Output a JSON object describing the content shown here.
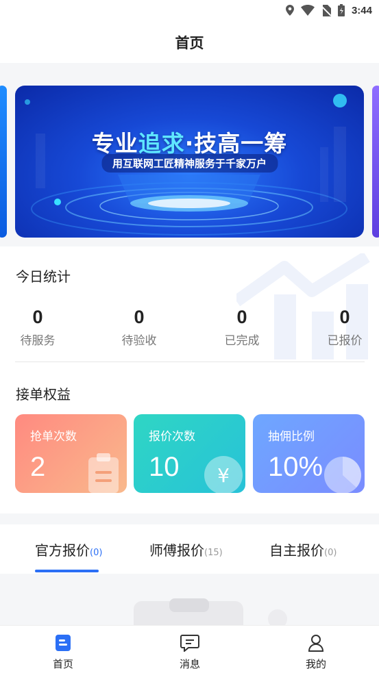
{
  "status_bar": {
    "time": "3:44",
    "icons": [
      "location-icon",
      "wifi-icon",
      "no-sim-icon",
      "battery-icon"
    ]
  },
  "header": {
    "title": "首页"
  },
  "banner": {
    "title_part1": "专业",
    "title_highlight": "追求",
    "title_part2": "·技高一筹",
    "subtitle": "用互联网工匠精神服务于千家万户"
  },
  "today_stats": {
    "title": "今日统计",
    "items": [
      {
        "value": "0",
        "label": "待服务"
      },
      {
        "value": "0",
        "label": "待验收"
      },
      {
        "value": "0",
        "label": "已完成"
      },
      {
        "value": "0",
        "label": "已报价"
      }
    ]
  },
  "benefits": {
    "title": "接单权益",
    "items": [
      {
        "label": "抢单次数",
        "value": "2",
        "icon": "clipboard-icon",
        "color_from": "#ff8a80",
        "color_to": "#f9b98c"
      },
      {
        "label": "报价次数",
        "value": "10",
        "icon": "yen-coin-icon",
        "color_from": "#2fd6c4",
        "color_to": "#27c2d8"
      },
      {
        "label": "抽佣比例",
        "value": "10%",
        "icon": "pie-chart-icon",
        "color_from": "#6ea7ff",
        "color_to": "#7a8cff"
      }
    ]
  },
  "tabs": [
    {
      "label": "官方报价",
      "count": "(0)",
      "active": true
    },
    {
      "label": "师傅报价",
      "count": "(15)",
      "active": false
    },
    {
      "label": "自主报价",
      "count": "(0)",
      "active": false
    }
  ],
  "bottom_nav": [
    {
      "label": "首页",
      "icon": "home-doc-icon",
      "active": true
    },
    {
      "label": "消息",
      "icon": "message-icon",
      "active": false
    },
    {
      "label": "我的",
      "icon": "user-icon",
      "active": false
    }
  ],
  "colors": {
    "accent": "#2b6ff5",
    "background": "#f5f6f8"
  }
}
